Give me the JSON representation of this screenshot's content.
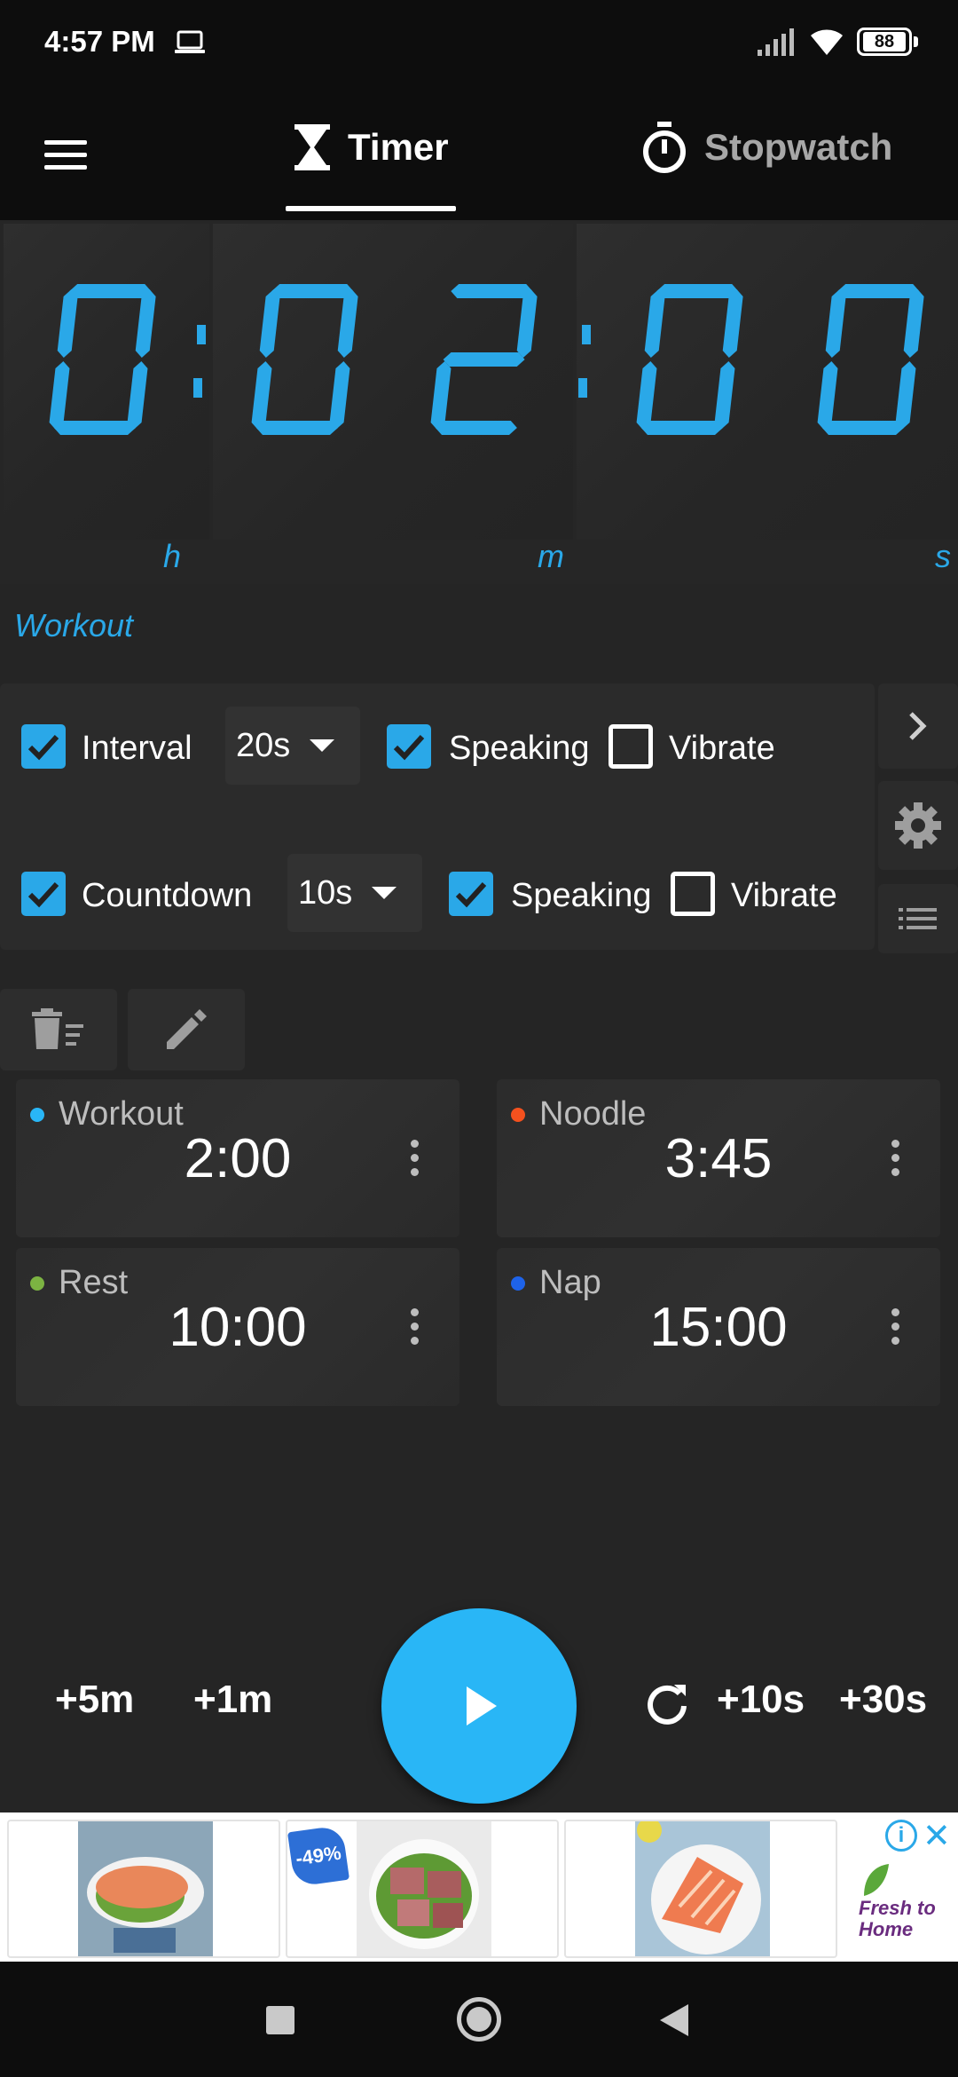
{
  "status_bar": {
    "time": "4:57 PM",
    "battery": "88"
  },
  "appbar": {
    "tab_timer": "Timer",
    "tab_stopwatch": "Stopwatch"
  },
  "display": {
    "digits": [
      "0",
      "0",
      "2",
      "0",
      "0"
    ],
    "units": {
      "h": "h",
      "m": "m",
      "s": "s"
    },
    "accent_color": "#2aa8e8"
  },
  "preset_name": "Workout",
  "options": {
    "interval": {
      "label": "Interval",
      "value": "20s",
      "checked": true,
      "speaking_label": "Speaking",
      "speaking_checked": true,
      "vibrate_label": "Vibrate",
      "vibrate_checked": false
    },
    "countdown": {
      "label": "Countdown",
      "value": "10s",
      "checked": true,
      "speaking_label": "Speaking",
      "speaking_checked": true,
      "vibrate_label": "Vibrate",
      "vibrate_checked": false
    }
  },
  "presets": [
    {
      "name": "Workout",
      "time": "2:00",
      "color": "#29b6f6"
    },
    {
      "name": "Noodle",
      "time": "3:45",
      "color": "#f4511e"
    },
    {
      "name": "Rest",
      "time": "10:00",
      "color": "#7cb342"
    },
    {
      "name": "Nap",
      "time": "15:00",
      "color": "#1e63e9"
    }
  ],
  "controls": {
    "plus_5m": "+5m",
    "plus_1m": "+1m",
    "plus_10s": "+10s",
    "plus_30s": "+30s",
    "play_color": "#29b6f6"
  },
  "ad": {
    "discount_badge": "-49%",
    "info": "i",
    "close": "✕",
    "brand": "Fresh to Home"
  }
}
